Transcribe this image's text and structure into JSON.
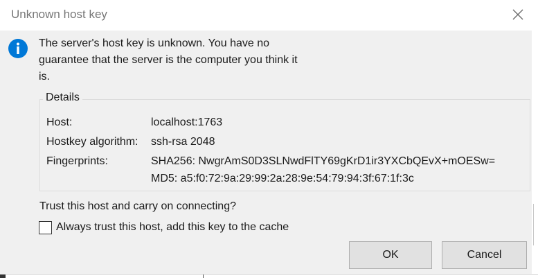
{
  "window": {
    "title": "Unknown host key"
  },
  "message": "The server's host key is unknown. You have no guarantee that the server is the computer you think it is.",
  "details": {
    "legend": "Details",
    "rows": [
      {
        "label": "Host:",
        "value": "localhost:1763"
      },
      {
        "label": "Hostkey algorithm:",
        "value": "ssh-rsa 2048"
      },
      {
        "label": "Fingerprints:",
        "value": "SHA256: NwgrAmS0D3SLNwdFlTY69gKrD1ir3YXCbQEvX+mOESw="
      },
      {
        "label": "",
        "value": "MD5: a5:f0:72:9a:29:99:2a:28:9e:54:79:94:3f:67:1f:3c"
      }
    ]
  },
  "prompt": "Trust this host and carry on connecting?",
  "checkbox": {
    "label": "Always trust this host, add this key to the cache",
    "checked": false
  },
  "buttons": {
    "ok": "OK",
    "cancel": "Cancel"
  },
  "icons": {
    "info": "info-icon",
    "close": "close-icon"
  },
  "colors": {
    "info_blue": "#0078d7",
    "title_gray": "#767676"
  }
}
